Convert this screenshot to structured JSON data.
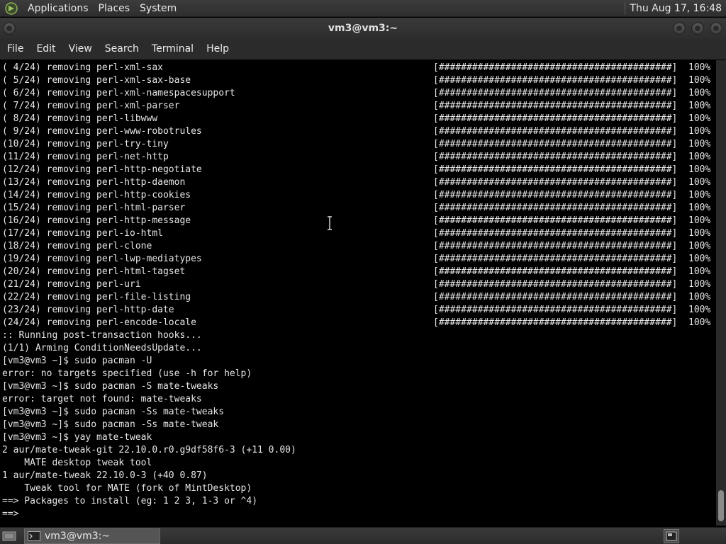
{
  "top_panel": {
    "menus": [
      "Applications",
      "Places",
      "System"
    ],
    "clock": "Thu Aug 17, 16:48"
  },
  "window": {
    "title": "vm3@vm3:~"
  },
  "menubar": [
    "File",
    "Edit",
    "View",
    "Search",
    "Terminal",
    "Help"
  ],
  "terminal": {
    "progress_rows": [
      {
        "text": "( 4/24) removing perl-xml-sax",
        "bar": "[##########################################]",
        "percent": "100%"
      },
      {
        "text": "( 5/24) removing perl-xml-sax-base",
        "bar": "[##########################################]",
        "percent": "100%"
      },
      {
        "text": "( 6/24) removing perl-xml-namespacesupport",
        "bar": "[##########################################]",
        "percent": "100%"
      },
      {
        "text": "( 7/24) removing perl-xml-parser",
        "bar": "[##########################################]",
        "percent": "100%"
      },
      {
        "text": "( 8/24) removing perl-libwww",
        "bar": "[##########################################]",
        "percent": "100%"
      },
      {
        "text": "( 9/24) removing perl-www-robotrules",
        "bar": "[##########################################]",
        "percent": "100%"
      },
      {
        "text": "(10/24) removing perl-try-tiny",
        "bar": "[##########################################]",
        "percent": "100%"
      },
      {
        "text": "(11/24) removing perl-net-http",
        "bar": "[##########################################]",
        "percent": "100%"
      },
      {
        "text": "(12/24) removing perl-http-negotiate",
        "bar": "[##########################################]",
        "percent": "100%"
      },
      {
        "text": "(13/24) removing perl-http-daemon",
        "bar": "[##########################################]",
        "percent": "100%"
      },
      {
        "text": "(14/24) removing perl-http-cookies",
        "bar": "[##########################################]",
        "percent": "100%"
      },
      {
        "text": "(15/24) removing perl-html-parser",
        "bar": "[##########################################]",
        "percent": "100%"
      },
      {
        "text": "(16/24) removing perl-http-message",
        "bar": "[##########################################]",
        "percent": "100%"
      },
      {
        "text": "(17/24) removing perl-io-html",
        "bar": "[##########################################]",
        "percent": "100%"
      },
      {
        "text": "(18/24) removing perl-clone",
        "bar": "[##########################################]",
        "percent": "100%"
      },
      {
        "text": "(19/24) removing perl-lwp-mediatypes",
        "bar": "[##########################################]",
        "percent": "100%"
      },
      {
        "text": "(20/24) removing perl-html-tagset",
        "bar": "[##########################################]",
        "percent": "100%"
      },
      {
        "text": "(21/24) removing perl-uri",
        "bar": "[##########################################]",
        "percent": "100%"
      },
      {
        "text": "(22/24) removing perl-file-listing",
        "bar": "[##########################################]",
        "percent": "100%"
      },
      {
        "text": "(23/24) removing perl-http-date",
        "bar": "[##########################################]",
        "percent": "100%"
      },
      {
        "text": "(24/24) removing perl-encode-locale",
        "bar": "[##########################################]",
        "percent": "100%"
      }
    ],
    "output_lines": [
      ":: Running post-transaction hooks...",
      "(1/1) Arming ConditionNeedsUpdate...",
      "[vm3@vm3 ~]$ sudo pacman -U",
      "error: no targets specified (use -h for help)",
      "[vm3@vm3 ~]$ sudo pacman -S mate-tweaks",
      "error: target not found: mate-tweaks",
      "[vm3@vm3 ~]$ sudo pacman -Ss mate-tweaks",
      "[vm3@vm3 ~]$ sudo pacman -Ss mate-tweak",
      "[vm3@vm3 ~]$ yay mate-tweak",
      "2 aur/mate-tweak-git 22.10.0.r0.g9df58f6-3 (+11 0.00)",
      "    MATE desktop tweak tool",
      "1 aur/mate-tweak 22.10.0-3 (+40 0.87)",
      "    Tweak tool for MATE (fork of MintDesktop)",
      "==> Packages to install (eg: 1 2 3, 1-3 or ^4)",
      "==> "
    ]
  },
  "taskbar": {
    "task_label": "vm3@vm3:~"
  },
  "colors": {
    "terminal_bg": "#000000",
    "terminal_fg": "#e6e6e6",
    "panel_bg": "#333333"
  }
}
